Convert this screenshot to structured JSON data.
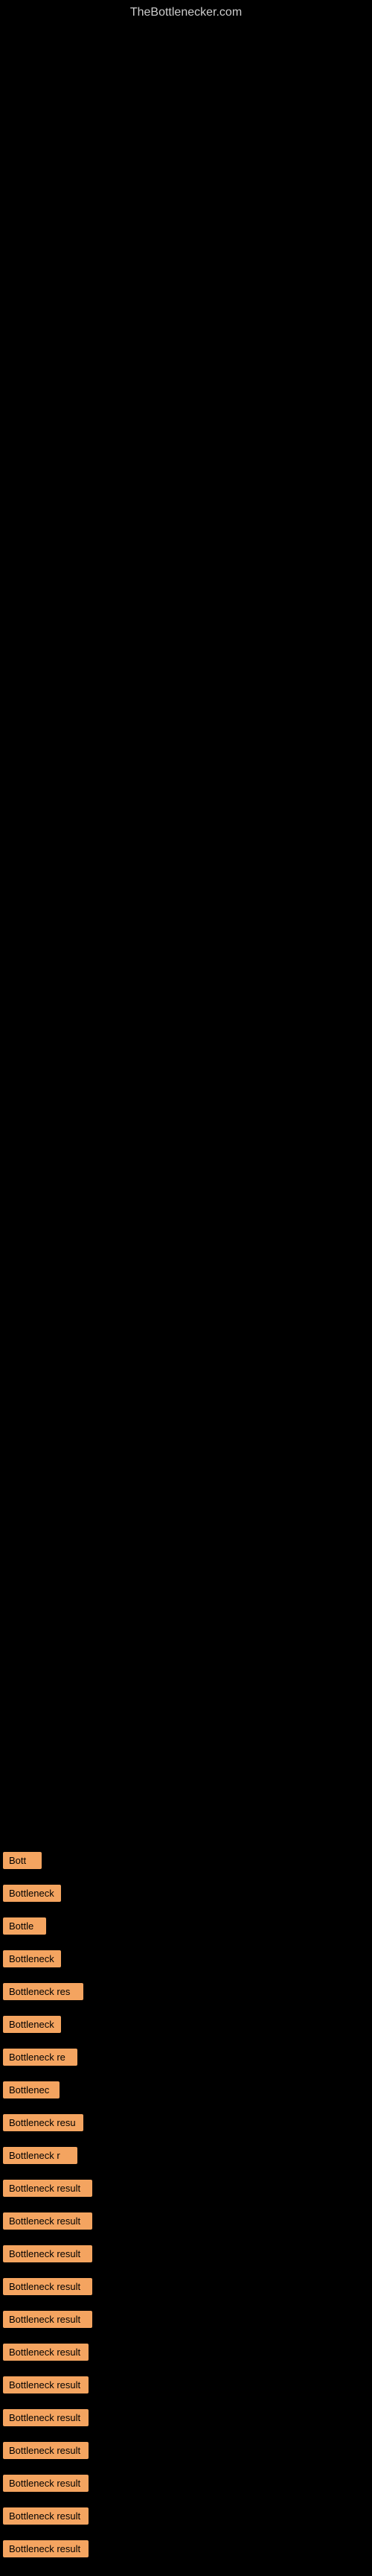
{
  "site": {
    "title": "TheBottlenecker.com"
  },
  "bottleneck_rows": [
    {
      "id": 1,
      "label": "Bott",
      "row_class": "row-1"
    },
    {
      "id": 2,
      "label": "Bottleneck",
      "row_class": "row-2"
    },
    {
      "id": 3,
      "label": "Bottle",
      "row_class": "row-3"
    },
    {
      "id": 4,
      "label": "Bottleneck",
      "row_class": "row-4"
    },
    {
      "id": 5,
      "label": "Bottleneck res",
      "row_class": "row-5"
    },
    {
      "id": 6,
      "label": "Bottleneck",
      "row_class": "row-6"
    },
    {
      "id": 7,
      "label": "Bottleneck re",
      "row_class": "row-7"
    },
    {
      "id": 8,
      "label": "Bottlenec",
      "row_class": "row-8"
    },
    {
      "id": 9,
      "label": "Bottleneck resu",
      "row_class": "row-9"
    },
    {
      "id": 10,
      "label": "Bottleneck r",
      "row_class": "row-10"
    },
    {
      "id": 11,
      "label": "Bottleneck result",
      "row_class": "row-11"
    },
    {
      "id": 12,
      "label": "Bottleneck result",
      "row_class": "row-12"
    },
    {
      "id": 13,
      "label": "Bottleneck result",
      "row_class": "row-13"
    },
    {
      "id": 14,
      "label": "Bottleneck result",
      "row_class": "row-14"
    },
    {
      "id": 15,
      "label": "Bottleneck result",
      "row_class": "row-15"
    },
    {
      "id": 16,
      "label": "Bottleneck result",
      "row_class": "row-16"
    },
    {
      "id": 17,
      "label": "Bottleneck result",
      "row_class": "row-17"
    },
    {
      "id": 18,
      "label": "Bottleneck result",
      "row_class": "row-18"
    },
    {
      "id": 19,
      "label": "Bottleneck result",
      "row_class": "row-19"
    },
    {
      "id": 20,
      "label": "Bottleneck result",
      "row_class": "row-20"
    },
    {
      "id": 21,
      "label": "Bottleneck result",
      "row_class": "row-21"
    },
    {
      "id": 22,
      "label": "Bottleneck result",
      "row_class": "row-22"
    }
  ]
}
